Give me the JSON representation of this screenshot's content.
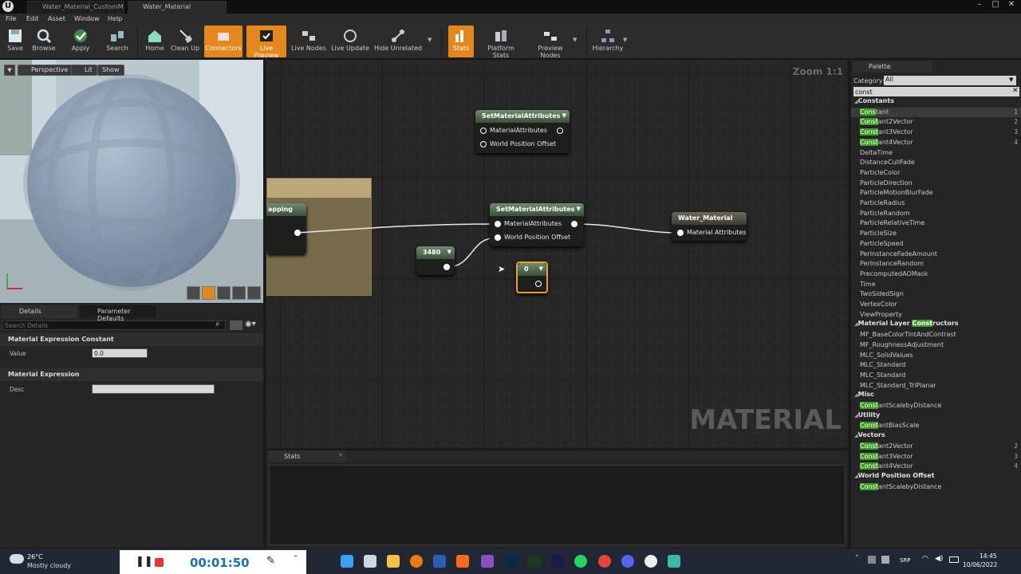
{
  "window": {
    "tabs": [
      {
        "label": "Water_Material_CustomM"
      },
      {
        "label": "Water_Material"
      }
    ]
  },
  "menu": [
    "File",
    "Edit",
    "Asset",
    "Window",
    "Help"
  ],
  "toolbar": {
    "buttons": [
      {
        "label": "Save",
        "icon": "save-icon"
      },
      {
        "label": "Browse",
        "icon": "browse-icon"
      },
      {
        "label": "Apply",
        "icon": "apply-check-icon"
      },
      {
        "label": "Search",
        "icon": "search-binoculars-icon"
      },
      {
        "label": "Home",
        "icon": "home-icon"
      },
      {
        "label": "Clean Up",
        "icon": "broom-icon"
      },
      {
        "label": "Connectors",
        "icon": "connectors-icon",
        "active": true
      },
      {
        "label": "Live Preview",
        "icon": "live-preview-icon",
        "active": true
      },
      {
        "label": "Live Nodes",
        "icon": "live-nodes-icon"
      },
      {
        "label": "Live Update",
        "icon": "live-update-icon"
      },
      {
        "label": "Hide Unrelated",
        "icon": "hide-unrelated-icon"
      },
      {
        "label": "Stats",
        "icon": "stats-icon",
        "active": true
      },
      {
        "label": "Platform Stats",
        "icon": "platform-stats-icon"
      },
      {
        "label": "Preview Nodes",
        "icon": "preview-nodes-icon"
      },
      {
        "label": "Hierarchy",
        "icon": "hierarchy-icon"
      }
    ]
  },
  "viewport": {
    "perspective": "Perspective",
    "lit": "Lit",
    "show": "Show"
  },
  "details": {
    "tab1": "Details",
    "tab2": "Parameter Defaults",
    "search_placeholder": "Search Details",
    "section1": "Material Expression Constant",
    "value_label": "Value",
    "value": "0.0",
    "section2": "Material Expression",
    "desc_label": "Desc",
    "desc": ""
  },
  "graph": {
    "zoom": "Zoom 1:1",
    "watermark": "MATERIAL",
    "node_set1": {
      "title": "SetMaterialAttributes",
      "pin1": "MaterialAttributes",
      "pin2": "World Position Offset"
    },
    "node_set2": {
      "title": "SetMaterialAttributes",
      "pin1": "MaterialAttributes",
      "pin2": "World Position Offset"
    },
    "node_result": {
      "title": "Water_Material",
      "pin1": "Material Attributes"
    },
    "node_const1": {
      "value": "3480"
    },
    "node_const2": {
      "value": "0"
    },
    "comment_fragment": "apping"
  },
  "stats": {
    "tab": "Stats"
  },
  "palette": {
    "title": "Palette",
    "category_label": "Category:",
    "category": "All",
    "search": "const",
    "groups": [
      {
        "name": "Constants",
        "items": [
          {
            "hl": "Cons",
            "rest": "tant",
            "num": "1"
          },
          {
            "hl": "Const",
            "rest": "ant2Vector",
            "num": "2"
          },
          {
            "hl": "Const",
            "rest": "ant3Vector",
            "num": "3"
          },
          {
            "hl": "Const",
            "rest": "ant4Vector",
            "num": "4"
          },
          {
            "text": "DeltaTime"
          },
          {
            "text": "DistanceCullFade"
          },
          {
            "text": "ParticleColor"
          },
          {
            "text": "ParticleDirection"
          },
          {
            "text": "ParticleMotionBlurFade"
          },
          {
            "text": "ParticleRadius"
          },
          {
            "text": "ParticleRandom"
          },
          {
            "text": "ParticleRelativeTime"
          },
          {
            "text": "ParticleSize"
          },
          {
            "text": "ParticleSpeed"
          },
          {
            "text": "PerInstanceFadeAmount"
          },
          {
            "text": "PerInstanceRandom"
          },
          {
            "text": "PrecomputedAOMask"
          },
          {
            "text": "Time"
          },
          {
            "text": "TwoSidedSign"
          },
          {
            "text": "VertexColor"
          },
          {
            "text": "ViewProperty"
          }
        ]
      },
      {
        "name_pre": "Material Layer ",
        "name_hl": "Const",
        "name_post": "ructors",
        "items": [
          {
            "text": "MF_BaseColorTintAndContrast"
          },
          {
            "text": "MF_RoughnessAdjustment"
          },
          {
            "text": "MLC_SolidValues"
          },
          {
            "text": "MLC_Standard"
          },
          {
            "text": "MLC_Standard"
          },
          {
            "text": "MLC_Standard_TriPlanar"
          }
        ]
      },
      {
        "name": "Misc",
        "items": [
          {
            "hl": "Const",
            "rest": "antScalebyDistance"
          }
        ]
      },
      {
        "name": "Utility",
        "items": [
          {
            "hl": "Const",
            "rest": "antBiasScale"
          }
        ]
      },
      {
        "name": "Vectors",
        "items": [
          {
            "hl": "Const",
            "rest": "ant2Vector",
            "num": "2"
          },
          {
            "hl": "Const",
            "rest": "ant3Vector",
            "num": "3"
          },
          {
            "hl": "Const",
            "rest": "ant4Vector",
            "num": "4"
          }
        ]
      },
      {
        "name": "World Position Offset",
        "items": [
          {
            "hl": "Const",
            "rest": "antScalebyDistance"
          }
        ]
      }
    ]
  },
  "taskbar": {
    "temp": "26°C",
    "weather": "Mostly cloudy",
    "timer": "00:01:50",
    "lang": "SRP",
    "time": "14:45",
    "date": "10/06/2022"
  }
}
